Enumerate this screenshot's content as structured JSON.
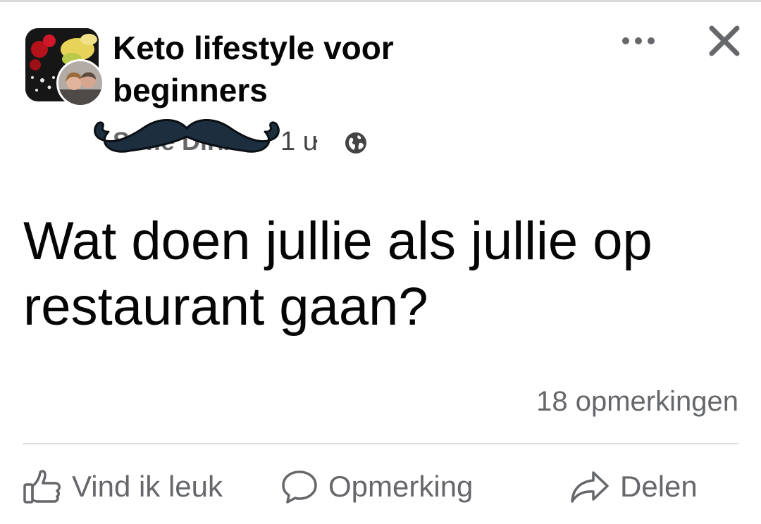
{
  "post": {
    "group_name": "Keto lifestyle voor beginners",
    "author_name": "Sofie Dirix",
    "time": "1 u",
    "separator": "·",
    "privacy_icon": "globe-icon",
    "text": "Wat doen jullie als jullie op restaurant gaan?",
    "comment_count": "18 opmerkingen"
  },
  "header": {
    "more_icon": "more-horizontal-icon",
    "close_icon": "close-icon"
  },
  "actions": {
    "like_label": "Vind ik leuk",
    "comment_label": "Opmerking",
    "share_label": "Delen"
  },
  "colors": {
    "text_primary": "#050505",
    "text_secondary": "#65676b",
    "divider": "#dddfe2",
    "mustache": "#1d2e3f"
  }
}
